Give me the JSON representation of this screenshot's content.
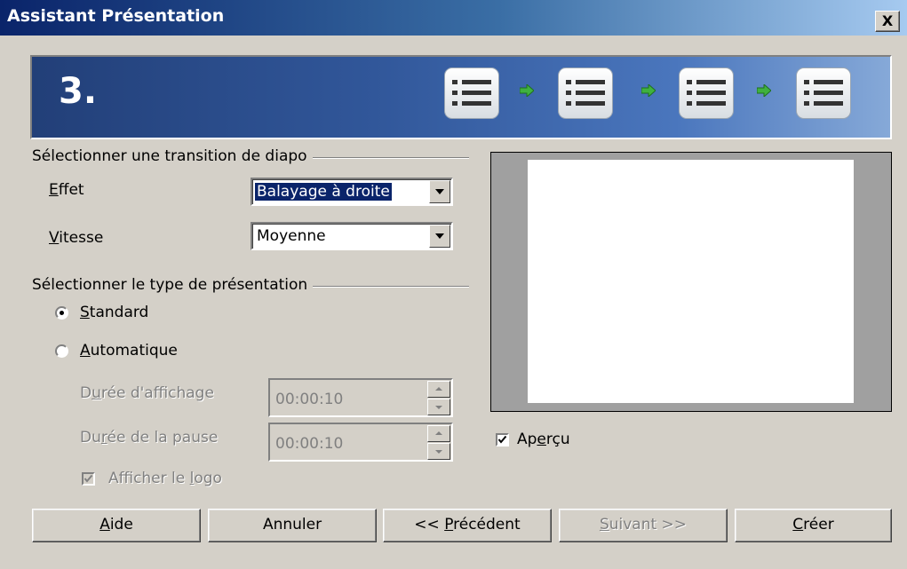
{
  "window": {
    "title": "Assistant Présentation",
    "close_label": "X"
  },
  "banner": {
    "step": "3.",
    "step_icons": [
      "list-icon",
      "list-icon",
      "list-icon",
      "list-icon"
    ],
    "arrow_color": "#3fb13f"
  },
  "transition_group": {
    "title": "Sélectionner une transition de diapo",
    "effect": {
      "label_mn": "E",
      "label_rest": "ffet",
      "value": "Balayage à droite"
    },
    "speed": {
      "label_mn": "V",
      "label_rest": "itesse",
      "value": "Moyenne"
    }
  },
  "type_group": {
    "title": "Sélectionner le type de présentation",
    "standard": {
      "mn": "S",
      "rest": "tandard",
      "checked": true
    },
    "automatic": {
      "mn": "A",
      "rest": "utomatique",
      "checked": false
    },
    "display_duration": {
      "pre": "D",
      "mn": "u",
      "rest": "rée d'affichage",
      "value": "00:00:10"
    },
    "pause_duration": {
      "pre": "Du",
      "mn": "r",
      "rest": "ée de la pause",
      "value": "00:00:10"
    },
    "show_logo": {
      "pre": "Afficher le ",
      "mn": "l",
      "rest": "ogo",
      "checked": true,
      "disabled": true
    }
  },
  "preview": {
    "label_pre": "Ap",
    "label_mn": "e",
    "label_rest": "rçu",
    "checked": true
  },
  "buttons": {
    "help": {
      "mn": "A",
      "rest": "ide"
    },
    "cancel": {
      "label": "Annuler"
    },
    "previous": {
      "pre": "<< ",
      "mn": "P",
      "rest": "récédent"
    },
    "next": {
      "mn": "S",
      "rest": "uivant >>",
      "disabled": true
    },
    "create": {
      "mn": "C",
      "rest": "réer"
    }
  }
}
